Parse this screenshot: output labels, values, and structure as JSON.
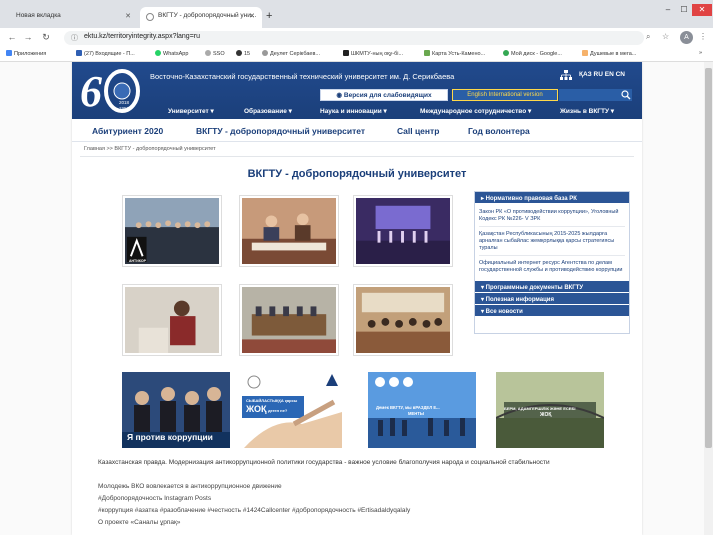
{
  "browser": {
    "tabs": [
      {
        "title": "Новая вкладка",
        "active": false
      },
      {
        "title": "ВКГТУ - добропорядочный уни...",
        "active": true
      }
    ],
    "url": "ektu.kz/territoryintegrity.aspx?lang=ru",
    "profile_initial": "A",
    "bookmarks": [
      {
        "label": "Приложения",
        "color": "#4285f4"
      },
      {
        "label": "(27) Входящие - П...",
        "color": "#2f5fb3"
      },
      {
        "label": "WhatsApp",
        "color": "#25d366"
      },
      {
        "label": "SSO",
        "color": "#aaaaaa"
      },
      {
        "label": "15",
        "color": "#333333"
      },
      {
        "label": "Деулет Серікбаев...",
        "color": "#999999"
      },
      {
        "label": "ШКМТУ-ның оқу-бі...",
        "color": "#222222"
      },
      {
        "label": "Карта Усть-Камено...",
        "color": "#6aa84f"
      },
      {
        "label": "Мой диск - Google...",
        "color": "#34a853"
      },
      {
        "label": "Душевые в мега...",
        "color": "#f6b26b"
      }
    ]
  },
  "site": {
    "university_name": "Восточно-Казахстанский государственный технический университет им. Д. Серикбаева",
    "logo_year": "1958",
    "logo_year2": "2018",
    "languages": "ҚАЗ RU EN CN",
    "visually_impaired_label": "Версия для слабовидящих",
    "english_label": "English International version",
    "search_placeholder": "",
    "main_nav": [
      "Университет ▾",
      "Образование ▾",
      "Наука и инновации ▾",
      "Международное сотрудничество ▾",
      "Жизнь в ВКГТУ ▾"
    ],
    "sub_nav": [
      "Абитуриент 2020",
      "ВКГТУ - добропорядочный университет",
      "Call центр",
      "Год волонтера"
    ],
    "breadcrumb": "Главная >> ВКГТУ - добропорядочный университет",
    "page_title": "ВКГТУ - добропорядочный университет",
    "sidebar": {
      "sections": [
        {
          "title": "▸ Нормативно правовая база РК"
        },
        {
          "title": "▾ Программные документы ВКГТУ"
        },
        {
          "title": "▾ Полезная информация"
        },
        {
          "title": "▾ Все новости"
        }
      ],
      "links": [
        "Закон РК «О противодействии коррупции», Уголовный Кодекс РК №226- V ЗРК",
        "Қазақстан Республикасының 2015-2025 жылдарға арналған сыбайлас жемқорлыққа қарсы стратегиясы туралы",
        "Официальный интернет ресурс Агентства по делам государственной службы и противодействию коррупции"
      ]
    },
    "banners": {
      "antikor_label": "АНТИКОР",
      "b1_text": "Я против коррупции",
      "b2_text_1": "СЫБАЙЛАСТЫҚҚА қарсы",
      "b2_text_2": "ЖОҚ",
      "b2_text_3": "деген не?",
      "b3_text_1": "Демек ВКГТУ, мы вРАЗДЕЛ Е...",
      "b3_text_2": "МЕНТЫ",
      "b4_text_1": "БЕРМ, АДАМГЕРШІЛІК ЖӘНЕ ЕСЕБІ",
      "b4_text_2": "ЖОҚ"
    },
    "news_headline": "Казахстанская правда. Модернизация антикоррупционной политики государства - важное условие благополучия народа и социальной стабильности",
    "news": [
      "Молодежь ВКО вовлекается в антикоррупционное движение",
      "#Добропорядочность Instagram Posts",
      "#коррупция #азатка #разоблачение #честность #1424Callcenter #добропорядочность #Ertisadaldyqalaly",
      "О проекте «Саналы ұрпақ»"
    ]
  }
}
